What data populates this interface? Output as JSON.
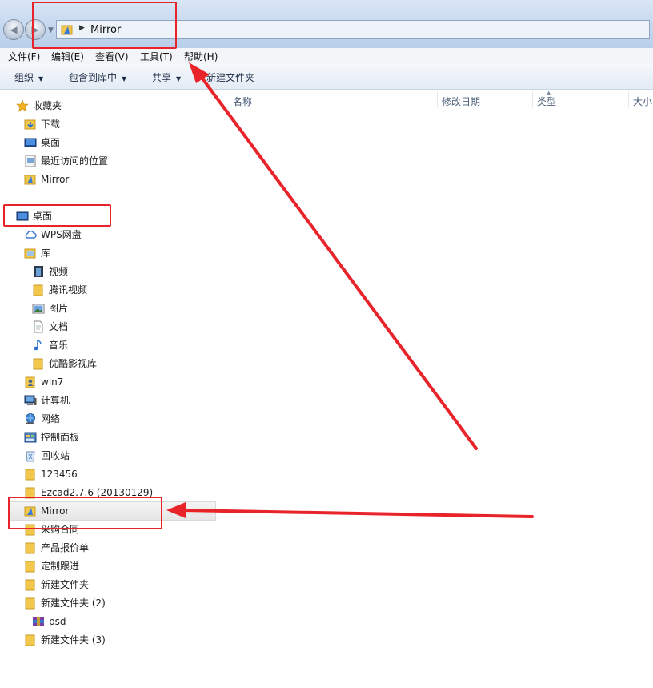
{
  "address": {
    "path": "Mirror"
  },
  "menu": [
    "文件(F)",
    "编辑(E)",
    "查看(V)",
    "工具(T)",
    "帮助(H)"
  ],
  "toolbar": {
    "organize": "组织",
    "include_library": "包含到库中",
    "share": "共享",
    "new_folder": "新建文件夹"
  },
  "columns": {
    "name": "名称",
    "modified": "修改日期",
    "type": "类型",
    "size": "大小"
  },
  "nav": {
    "favorites": "收藏夹",
    "downloads": "下载",
    "desktop_fav": "桌面",
    "recent": "最近访问的位置",
    "mirror_fav": "Mirror",
    "desktop": "桌面",
    "wps": "WPS网盘",
    "library": "库",
    "video": "视频",
    "tencent_video": "腾讯视频",
    "pictures": "图片",
    "documents": "文档",
    "music": "音乐",
    "youku": "优酷影视库",
    "win7": "win7",
    "computer": "计算机",
    "network": "网络",
    "control_panel": "控制面板",
    "recycle": "回收站",
    "f_123456": "123456",
    "ezcad": "Ezcad2.7.6 (20130129)",
    "mirror": "Mirror",
    "purchase": "采购合同",
    "quote": "产品报价单",
    "custom": "定制跟进",
    "new1": "新建文件夹",
    "new2": "新建文件夹 (2)",
    "psd": "psd",
    "new3": "新建文件夹 (3)"
  },
  "colors": {
    "annotation": "#e8232a",
    "folder": "#f1c84b"
  }
}
